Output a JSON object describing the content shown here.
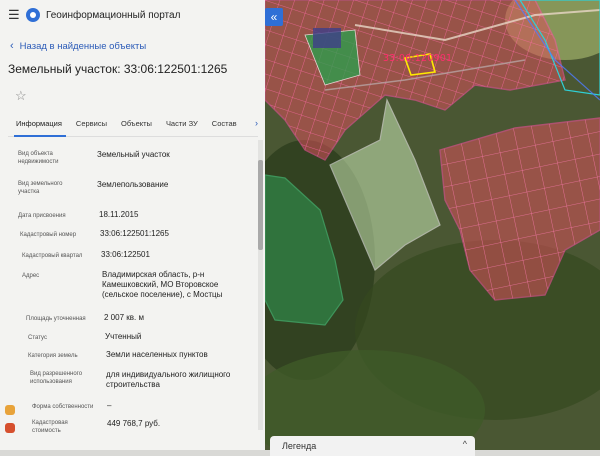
{
  "app": {
    "title": "Геоинформационный портал"
  },
  "nav": {
    "back_label": "Назад в найденные объекты"
  },
  "object": {
    "title": "Земельный участок: 33:06:122501:1265"
  },
  "tabs": [
    {
      "label": "Информация",
      "active": true
    },
    {
      "label": "Сервисы",
      "active": false
    },
    {
      "label": "Объекты",
      "active": false
    },
    {
      "label": "Части ЗУ",
      "active": false
    },
    {
      "label": "Состав",
      "active": false
    }
  ],
  "fields": [
    {
      "label": "Вид объекта недвижимости",
      "value": "Земельный участок"
    },
    {
      "label": "Вид земельного участка",
      "value": "Землепользование"
    },
    {
      "label": "Дата присвоения",
      "value": "18.11.2015"
    },
    {
      "label": "Кадастровый номер",
      "value": "33:06:122501:1265"
    },
    {
      "label": "Кадастровый квартал",
      "value": "33:06:122501"
    },
    {
      "label": "Адрес",
      "value": "Владимирская область, р-н Камешковский, МО Второвское (сельское поселение), с Мостцы"
    },
    {
      "label": "Площадь уточненная",
      "value": "2 007 кв. м"
    },
    {
      "label": "Статус",
      "value": "Учтенный"
    },
    {
      "label": "Категория земель",
      "value": "Земли населенных пунктов"
    },
    {
      "label": "Вид разрешенного использования",
      "value": "для индивидуального жилищного строительства"
    },
    {
      "label": "Форма собственности",
      "value": "–"
    },
    {
      "label": "Кадастровая стоимость",
      "value": "449 768,7 руб."
    }
  ],
  "map": {
    "parcel_label": "33:06:120901",
    "legend_label": "Легенда",
    "collapse_icon": "«"
  },
  "colors": {
    "accent": "#2f6fd6",
    "parcel_fill": "#d9505a",
    "parcel_line": "#ff4fa0",
    "zone_green": "#7fd6a6",
    "cadastral_label": "#ff2e6d"
  }
}
